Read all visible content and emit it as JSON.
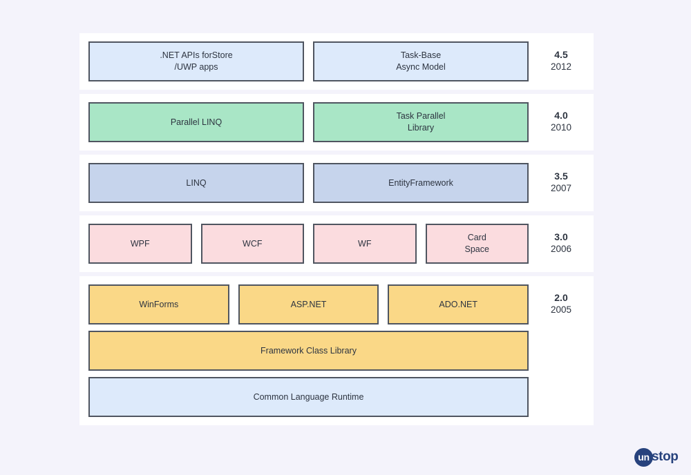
{
  "background_color": "#f4f3fb",
  "card_color": "#ffffff",
  "border_color": "#4f5560",
  "rows": [
    {
      "version": "4.5",
      "year": "2012",
      "color": "#ddeafb",
      "boxes": [
        {
          "line1": ".NET APIs  forStore",
          "line2": "/UWP apps"
        },
        {
          "line1": "Task-Base",
          "line2": "Async Model"
        }
      ]
    },
    {
      "version": "4.0",
      "year": "2010",
      "color": "#a9e6c6",
      "boxes": [
        {
          "line1": "Parallel LINQ",
          "line2": ""
        },
        {
          "line1": "Task Parallel",
          "line2": "Library"
        }
      ]
    },
    {
      "version": "3.5",
      "year": "2007",
      "color": "#c6d4ec",
      "boxes": [
        {
          "line1": "LINQ",
          "line2": ""
        },
        {
          "line1": "EntityFramework",
          "line2": ""
        }
      ]
    },
    {
      "version": "3.0",
      "year": "2006",
      "color": "#fbdcdf",
      "boxes": [
        {
          "line1": "WPF",
          "line2": ""
        },
        {
          "line1": "WCF",
          "line2": ""
        },
        {
          "line1": "WF",
          "line2": ""
        },
        {
          "line1": "Card",
          "line2": "Space"
        }
      ]
    }
  ],
  "base_row": {
    "version": "2.0",
    "year": "2005",
    "top_boxes": [
      {
        "label": "WinForms",
        "color": "#fad887"
      },
      {
        "label": "ASP.NET",
        "color": "#fad887"
      },
      {
        "label": "ADO.NET",
        "color": "#fad887"
      }
    ],
    "framework_class_library": {
      "label": "Framework Class Library",
      "color": "#fad887"
    },
    "common_language_runtime": {
      "label": "Common Language Runtime",
      "color": "#ddeafb"
    }
  },
  "logo": {
    "circle_text": "un",
    "word_text": "stop",
    "color": "#27427d"
  }
}
